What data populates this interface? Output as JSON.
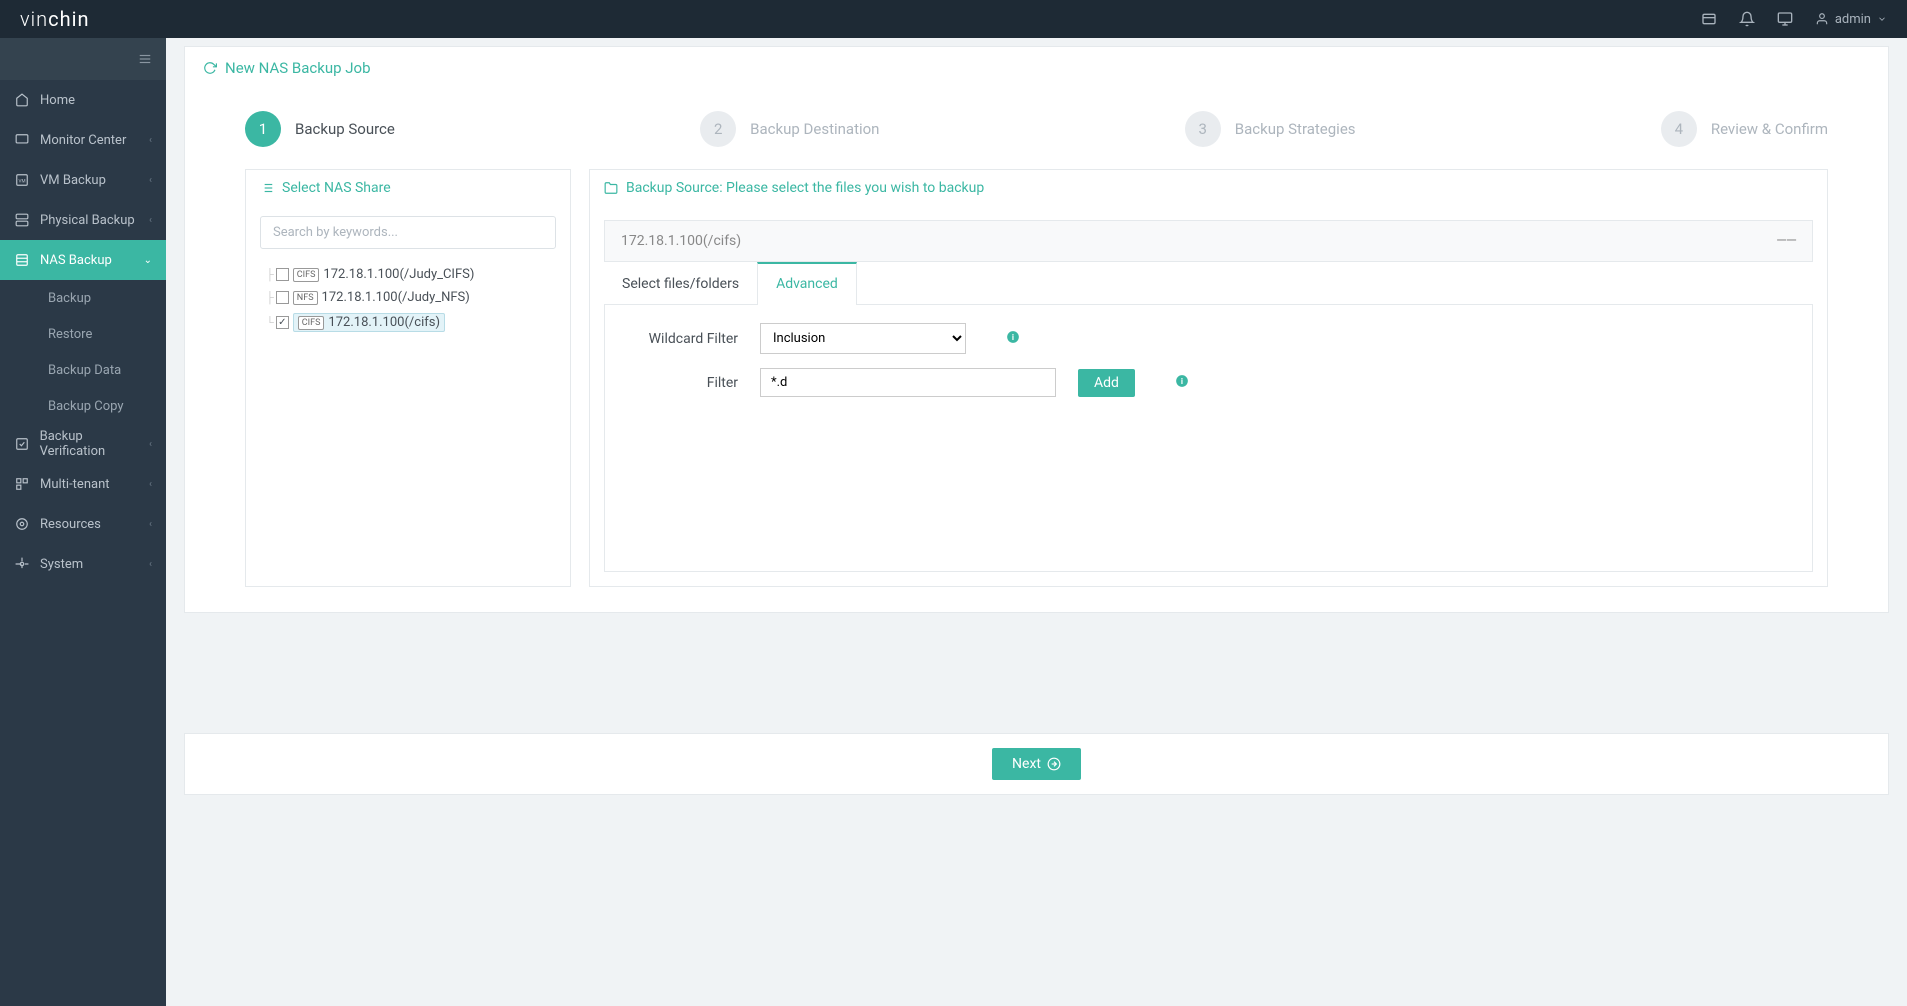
{
  "brand": {
    "part1": "vin",
    "part2": "chin"
  },
  "topbar": {
    "user": "admin"
  },
  "sidebar": {
    "items": [
      {
        "label": "Home"
      },
      {
        "label": "Monitor Center"
      },
      {
        "label": "VM Backup"
      },
      {
        "label": "Physical Backup"
      },
      {
        "label": "NAS Backup"
      },
      {
        "label": "Backup Verification"
      },
      {
        "label": "Multi-tenant"
      },
      {
        "label": "Resources"
      },
      {
        "label": "System"
      }
    ],
    "sub": [
      {
        "label": "Backup"
      },
      {
        "label": "Restore"
      },
      {
        "label": "Backup Data"
      },
      {
        "label": "Backup Copy"
      }
    ]
  },
  "page": {
    "title": "New NAS Backup Job"
  },
  "wizard": {
    "steps": [
      {
        "num": "1",
        "label": "Backup Source"
      },
      {
        "num": "2",
        "label": "Backup Destination"
      },
      {
        "num": "3",
        "label": "Backup Strategies"
      },
      {
        "num": "4",
        "label": "Review & Confirm"
      }
    ]
  },
  "leftPanel": {
    "title": "Select NAS Share",
    "searchPlaceholder": "Search by keywords...",
    "tree": [
      {
        "badge": "CIFS",
        "label": "172.18.1.100(/Judy_CIFS)",
        "checked": false
      },
      {
        "badge": "NFS",
        "label": "172.18.1.100(/Judy_NFS)",
        "checked": false
      },
      {
        "badge": "CIFS",
        "label": "172.18.1.100(/cifs)",
        "checked": true
      }
    ]
  },
  "rightPanel": {
    "title": "Backup Source: Please select the files you wish to backup",
    "sourceLabel": "172.18.1.100(/cifs)",
    "tabs": {
      "select": "Select files/folders",
      "advanced": "Advanced"
    },
    "form": {
      "wildcardLabel": "Wildcard Filter",
      "wildcardValue": "Inclusion",
      "filterLabel": "Filter",
      "filterValue": "*.d",
      "addButton": "Add"
    }
  },
  "footer": {
    "next": "Next"
  }
}
